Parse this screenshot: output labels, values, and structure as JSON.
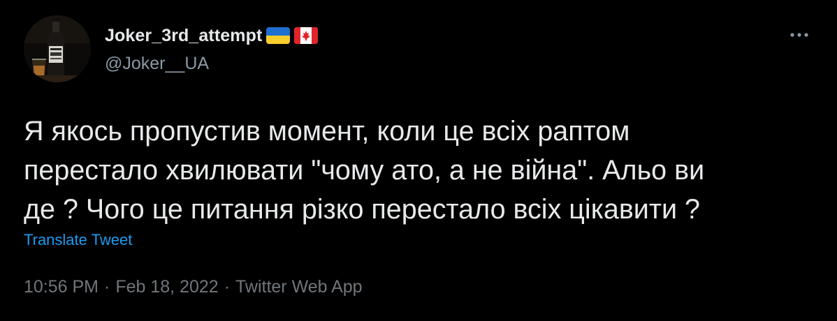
{
  "author": {
    "display_name": "Joker_3rd_attempt",
    "handle": "@Joker__UA",
    "avatar": "jack-daniels-bottle-avatar",
    "flags": [
      "ukraine-flag-icon",
      "canada-flag-icon"
    ]
  },
  "tweet": {
    "lines": [
      "Я якось пропустив момент, коли це всіх раптом",
      "перестало хвилювати \"чому ато, а не війна\". Альо ви",
      "де ? Чого це питання різко перестало всіх цікавити ?"
    ],
    "translate_label": "Translate Tweet"
  },
  "meta": {
    "time": "10:56 PM",
    "separator": "·",
    "date": "Feb 18, 2022",
    "source": "Twitter Web App"
  },
  "colors": {
    "background": "#000000",
    "text": "#e7e9ea",
    "secondary_text": "#8b98a5",
    "meta_text": "#71767b",
    "link": "#1d9bf0"
  },
  "icons": {
    "more": "more-horizontal-icon"
  }
}
